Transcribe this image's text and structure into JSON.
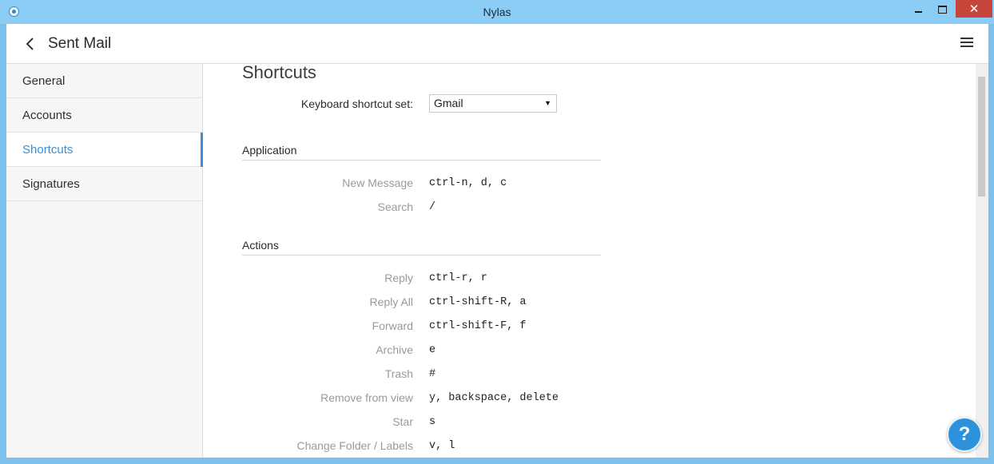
{
  "window": {
    "title": "Nylas",
    "close_glyph": "✕"
  },
  "header": {
    "title": "Sent Mail",
    "back_icon": "chevron-left-icon",
    "menu_icon": "hamburger-menu-icon"
  },
  "sidebar": {
    "items": [
      {
        "label": "General",
        "active": false
      },
      {
        "label": "Accounts",
        "active": false
      },
      {
        "label": "Shortcuts",
        "active": true
      },
      {
        "label": "Signatures",
        "active": false
      }
    ]
  },
  "main": {
    "heading": "Shortcuts",
    "shortcut_set_label": "Keyboard shortcut set:",
    "shortcut_set_value": "Gmail",
    "groups": [
      {
        "title": "Application",
        "rows": [
          {
            "label": "New Message",
            "keys": "ctrl-n, d, c"
          },
          {
            "label": "Search",
            "keys": "/"
          }
        ]
      },
      {
        "title": "Actions",
        "rows": [
          {
            "label": "Reply",
            "keys": "ctrl-r, r"
          },
          {
            "label": "Reply All",
            "keys": "ctrl-shift-R, a"
          },
          {
            "label": "Forward",
            "keys": "ctrl-shift-F, f"
          },
          {
            "label": "Archive",
            "keys": "e"
          },
          {
            "label": "Trash",
            "keys": "#"
          },
          {
            "label": "Remove from view",
            "keys": "y, backspace, delete"
          },
          {
            "label": "Star",
            "keys": "s"
          },
          {
            "label": "Change Folder / Labels",
            "keys": "v, l"
          }
        ]
      }
    ]
  },
  "help": {
    "label": "?"
  },
  "colors": {
    "accent": "#3a8fd6",
    "titlebar": "#8ccdf5",
    "close": "#c7463b"
  }
}
